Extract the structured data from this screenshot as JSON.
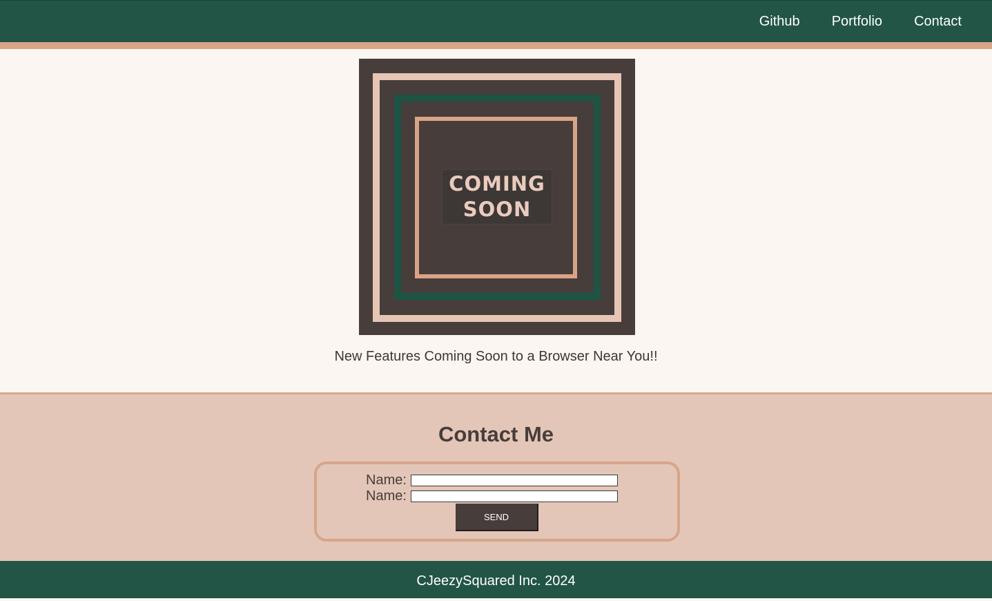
{
  "header": {
    "nav": [
      {
        "label": "Github"
      },
      {
        "label": "Portfolio"
      },
      {
        "label": "Contact"
      }
    ],
    "colors": {
      "bar": "#225545",
      "stripe": "#d9a586"
    }
  },
  "hero": {
    "poster": {
      "line1": "COMING",
      "line2": "SOON",
      "colors": {
        "background": "#473d3b",
        "outer_ring": "#e6c5b5",
        "middle_ring": "#1e5444",
        "inner_ring": "#d8a387"
      }
    },
    "tagline": "New Features Coming Soon to a Browser Near You!!"
  },
  "contact": {
    "title": "Contact Me",
    "fields": [
      {
        "label": "Name:",
        "value": ""
      },
      {
        "label": "Name:",
        "value": ""
      }
    ],
    "send_label": "SEND",
    "colors": {
      "background": "#e3c6b7",
      "border": "#d6a68a",
      "button": "#473d3b"
    }
  },
  "footer": {
    "text": "CJeezySquared Inc. 2024"
  }
}
